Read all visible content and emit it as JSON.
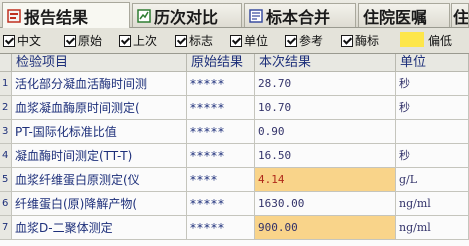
{
  "tabs": [
    {
      "label": "报告结果",
      "icon": "report-icon",
      "active": true
    },
    {
      "label": "历次对比",
      "icon": "compare-icon",
      "active": false
    },
    {
      "label": "标本合并",
      "icon": "merge-icon",
      "active": false
    },
    {
      "label": "住院医嘱",
      "icon": "order-icon",
      "active": false
    },
    {
      "label": "住",
      "icon": "",
      "active": false
    }
  ],
  "options": [
    {
      "label": "中文",
      "checked": true
    },
    {
      "label": "原始",
      "checked": true
    },
    {
      "label": "上次",
      "checked": true
    },
    {
      "label": "标志",
      "checked": true
    },
    {
      "label": "单位",
      "checked": true
    },
    {
      "label": "参考",
      "checked": true
    },
    {
      "label": "酶标",
      "checked": true
    }
  ],
  "legend": {
    "swatch_color": "#fde64a",
    "label": "偏低"
  },
  "table": {
    "columns": [
      "检验项目",
      "原始结果",
      "本次结果",
      "单位"
    ],
    "rows": [
      {
        "idx": "1",
        "name": "活化部分凝血活酶时间测",
        "orig": "*****",
        "cur": "28.70",
        "unit": "秒",
        "highlight": false
      },
      {
        "idx": "2",
        "name": "血浆凝血酶原时间测定(",
        "orig": "*****",
        "cur": "10.70",
        "unit": "秒",
        "highlight": false
      },
      {
        "idx": "3",
        "name": "PT-国际化标准比值",
        "orig": "*****",
        "cur": "0.90",
        "unit": "",
        "highlight": false
      },
      {
        "idx": "4",
        "name": "凝血酶时间测定(TT-T)",
        "orig": "*****",
        "cur": "16.50",
        "unit": "秒",
        "highlight": false
      },
      {
        "idx": "5",
        "name": "血浆纤维蛋白原测定(仪",
        "orig": "****",
        "cur": "4.14",
        "unit": "g/L",
        "highlight": true
      },
      {
        "idx": "6",
        "name": "纤维蛋白(原)降解产物(",
        "orig": "*****",
        "cur": "1630.00",
        "unit": "ng/ml",
        "highlight": false
      },
      {
        "idx": "7",
        "name": "血浆D-二聚体测定",
        "orig": "*****",
        "cur": "900.00",
        "unit": "ng/ml",
        "highlight": true
      }
    ]
  }
}
